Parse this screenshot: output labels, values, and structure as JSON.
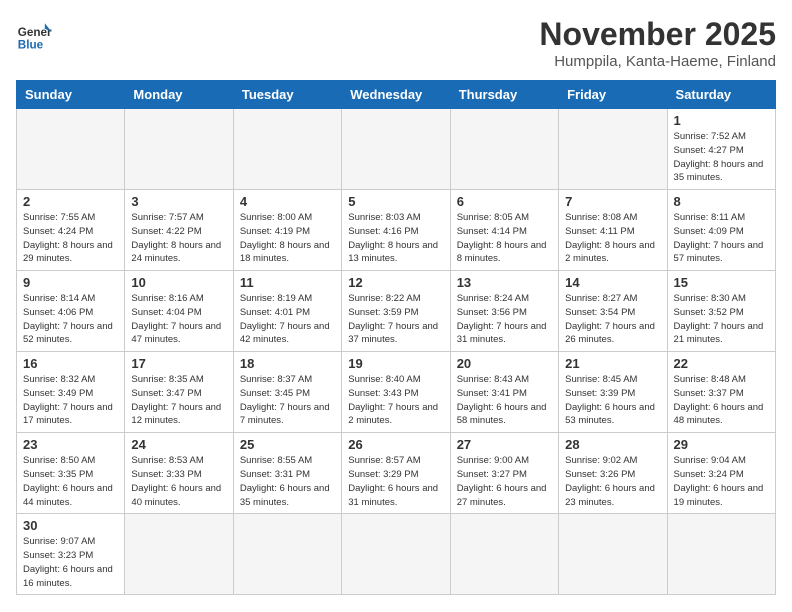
{
  "header": {
    "logo_general": "General",
    "logo_blue": "Blue",
    "month_title": "November 2025",
    "location": "Humppila, Kanta-Haeme, Finland"
  },
  "weekdays": [
    "Sunday",
    "Monday",
    "Tuesday",
    "Wednesday",
    "Thursday",
    "Friday",
    "Saturday"
  ],
  "weeks": [
    [
      {
        "day": "",
        "info": ""
      },
      {
        "day": "",
        "info": ""
      },
      {
        "day": "",
        "info": ""
      },
      {
        "day": "",
        "info": ""
      },
      {
        "day": "",
        "info": ""
      },
      {
        "day": "",
        "info": ""
      },
      {
        "day": "1",
        "info": "Sunrise: 7:52 AM\nSunset: 4:27 PM\nDaylight: 8 hours\nand 35 minutes."
      }
    ],
    [
      {
        "day": "2",
        "info": "Sunrise: 7:55 AM\nSunset: 4:24 PM\nDaylight: 8 hours\nand 29 minutes."
      },
      {
        "day": "3",
        "info": "Sunrise: 7:57 AM\nSunset: 4:22 PM\nDaylight: 8 hours\nand 24 minutes."
      },
      {
        "day": "4",
        "info": "Sunrise: 8:00 AM\nSunset: 4:19 PM\nDaylight: 8 hours\nand 18 minutes."
      },
      {
        "day": "5",
        "info": "Sunrise: 8:03 AM\nSunset: 4:16 PM\nDaylight: 8 hours\nand 13 minutes."
      },
      {
        "day": "6",
        "info": "Sunrise: 8:05 AM\nSunset: 4:14 PM\nDaylight: 8 hours\nand 8 minutes."
      },
      {
        "day": "7",
        "info": "Sunrise: 8:08 AM\nSunset: 4:11 PM\nDaylight: 8 hours\nand 2 minutes."
      },
      {
        "day": "8",
        "info": "Sunrise: 8:11 AM\nSunset: 4:09 PM\nDaylight: 7 hours\nand 57 minutes."
      }
    ],
    [
      {
        "day": "9",
        "info": "Sunrise: 8:14 AM\nSunset: 4:06 PM\nDaylight: 7 hours\nand 52 minutes."
      },
      {
        "day": "10",
        "info": "Sunrise: 8:16 AM\nSunset: 4:04 PM\nDaylight: 7 hours\nand 47 minutes."
      },
      {
        "day": "11",
        "info": "Sunrise: 8:19 AM\nSunset: 4:01 PM\nDaylight: 7 hours\nand 42 minutes."
      },
      {
        "day": "12",
        "info": "Sunrise: 8:22 AM\nSunset: 3:59 PM\nDaylight: 7 hours\nand 37 minutes."
      },
      {
        "day": "13",
        "info": "Sunrise: 8:24 AM\nSunset: 3:56 PM\nDaylight: 7 hours\nand 31 minutes."
      },
      {
        "day": "14",
        "info": "Sunrise: 8:27 AM\nSunset: 3:54 PM\nDaylight: 7 hours\nand 26 minutes."
      },
      {
        "day": "15",
        "info": "Sunrise: 8:30 AM\nSunset: 3:52 PM\nDaylight: 7 hours\nand 21 minutes."
      }
    ],
    [
      {
        "day": "16",
        "info": "Sunrise: 8:32 AM\nSunset: 3:49 PM\nDaylight: 7 hours\nand 17 minutes."
      },
      {
        "day": "17",
        "info": "Sunrise: 8:35 AM\nSunset: 3:47 PM\nDaylight: 7 hours\nand 12 minutes."
      },
      {
        "day": "18",
        "info": "Sunrise: 8:37 AM\nSunset: 3:45 PM\nDaylight: 7 hours\nand 7 minutes."
      },
      {
        "day": "19",
        "info": "Sunrise: 8:40 AM\nSunset: 3:43 PM\nDaylight: 7 hours\nand 2 minutes."
      },
      {
        "day": "20",
        "info": "Sunrise: 8:43 AM\nSunset: 3:41 PM\nDaylight: 6 hours\nand 58 minutes."
      },
      {
        "day": "21",
        "info": "Sunrise: 8:45 AM\nSunset: 3:39 PM\nDaylight: 6 hours\nand 53 minutes."
      },
      {
        "day": "22",
        "info": "Sunrise: 8:48 AM\nSunset: 3:37 PM\nDaylight: 6 hours\nand 48 minutes."
      }
    ],
    [
      {
        "day": "23",
        "info": "Sunrise: 8:50 AM\nSunset: 3:35 PM\nDaylight: 6 hours\nand 44 minutes."
      },
      {
        "day": "24",
        "info": "Sunrise: 8:53 AM\nSunset: 3:33 PM\nDaylight: 6 hours\nand 40 minutes."
      },
      {
        "day": "25",
        "info": "Sunrise: 8:55 AM\nSunset: 3:31 PM\nDaylight: 6 hours\nand 35 minutes."
      },
      {
        "day": "26",
        "info": "Sunrise: 8:57 AM\nSunset: 3:29 PM\nDaylight: 6 hours\nand 31 minutes."
      },
      {
        "day": "27",
        "info": "Sunrise: 9:00 AM\nSunset: 3:27 PM\nDaylight: 6 hours\nand 27 minutes."
      },
      {
        "day": "28",
        "info": "Sunrise: 9:02 AM\nSunset: 3:26 PM\nDaylight: 6 hours\nand 23 minutes."
      },
      {
        "day": "29",
        "info": "Sunrise: 9:04 AM\nSunset: 3:24 PM\nDaylight: 6 hours\nand 19 minutes."
      }
    ],
    [
      {
        "day": "30",
        "info": "Sunrise: 9:07 AM\nSunset: 3:23 PM\nDaylight: 6 hours\nand 16 minutes."
      },
      {
        "day": "",
        "info": ""
      },
      {
        "day": "",
        "info": ""
      },
      {
        "day": "",
        "info": ""
      },
      {
        "day": "",
        "info": ""
      },
      {
        "day": "",
        "info": ""
      },
      {
        "day": "",
        "info": ""
      }
    ]
  ]
}
